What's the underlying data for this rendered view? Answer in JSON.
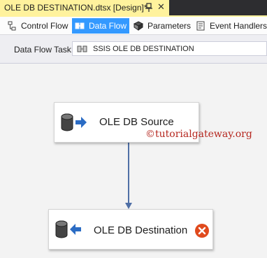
{
  "document_tab": {
    "title": "OLE DB DESTINATION.dtsx [Design]*",
    "pin_icon": "pin-icon",
    "close_glyph": "✕"
  },
  "designer_tabs": [
    {
      "label": "Control Flow",
      "icon": "control-flow-icon",
      "active": false
    },
    {
      "label": "Data Flow",
      "icon": "data-flow-icon",
      "active": true
    },
    {
      "label": "Parameters",
      "icon": "parameters-icon",
      "active": false
    },
    {
      "label": "Event Handlers",
      "icon": "event-handlers-icon",
      "active": false
    }
  ],
  "task_bar": {
    "label": "Data Flow Task:",
    "selected": "SSIS OLE DB DESTINATION"
  },
  "components": {
    "source": {
      "label": "OLE DB Source",
      "icon": "ole-db-source-icon"
    },
    "destination": {
      "label": "OLE DB Destination",
      "icon": "ole-db-destination-icon",
      "status_icon": "error-icon"
    }
  },
  "watermark": "©tutorialgateway.org",
  "colors": {
    "tab_highlight": "#fff29d",
    "active_tab": "#3399ff",
    "error": "#e04a1d",
    "connector": "#4f6fa6"
  }
}
